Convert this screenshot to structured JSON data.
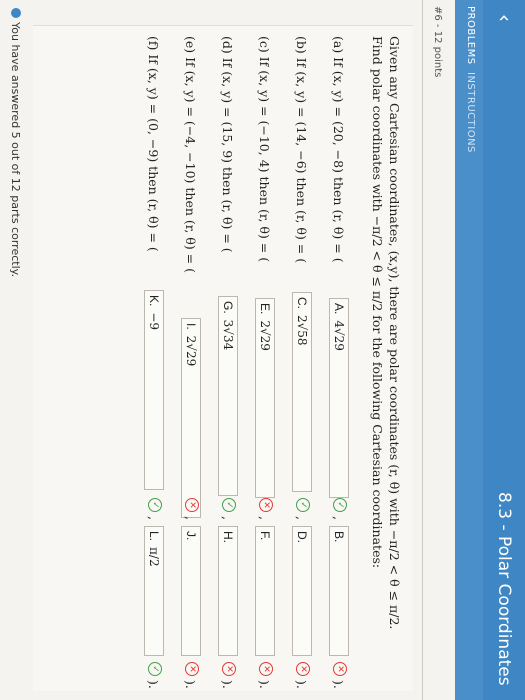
{
  "header": {
    "back_icon": "chevron-left-icon",
    "title": "8.3 - Polar Coordinates"
  },
  "tabs": [
    {
      "label": "PROBLEMS"
    },
    {
      "label": "INSTRUCTIONS"
    }
  ],
  "problem": {
    "points": "#6 - 12 points",
    "stem_line1": "Given any Cartesian coordinates, (x,y), there are polar coordinates (r, θ) with −π/2 < θ ≤ π/2.",
    "stem_line2": "Find polar coordinates with −π/2 < θ ≤ π/2 for the following Cartesian coordinates:"
  },
  "parts": [
    {
      "question": "(a) If (x, y) = (20, −8) then (r, θ) = (",
      "r_letter": "A.",
      "r_value": "4√29",
      "r_status": "ok",
      "t_letter": "B.",
      "t_value": "",
      "t_status": "bad"
    },
    {
      "question": "(b) If (x, y) = (14, −6) then (r, θ) = (",
      "r_letter": "C.",
      "r_value": "2√58",
      "r_status": "ok",
      "t_letter": "D.",
      "t_value": "",
      "t_status": "bad"
    },
    {
      "question": "(c) If (x, y) = (−10, 4) then (r, θ) = (",
      "r_letter": "E.",
      "r_value": "2√29",
      "r_status": "bad",
      "t_letter": "F.",
      "t_value": "",
      "t_status": "bad"
    },
    {
      "question": "(d) If (x, y) = (15, 9) then (r, θ) = (",
      "r_letter": "G.",
      "r_value": "3√34",
      "r_status": "ok",
      "t_letter": "H.",
      "t_value": "",
      "t_status": "bad"
    },
    {
      "question": "(e) If (x, y) = (−4, −10) then (r, θ) = (",
      "r_letter": "I.",
      "r_value": "2√29",
      "r_status": "bad",
      "t_letter": "J.",
      "t_value": "",
      "t_status": "bad"
    },
    {
      "question": "(f) If (x, y) = (0, −9) then (r, θ) = (",
      "r_letter": "K.",
      "r_value": "−9",
      "r_status": "ok",
      "t_letter": "L.",
      "t_value": "π/2",
      "t_status": "ok"
    }
  ],
  "status_text": "You have answered 5 out of 12 parts correctly.",
  "colors": {
    "header_blue": "#3f86c5",
    "correct": "#43a047",
    "incorrect": "#e53935"
  }
}
